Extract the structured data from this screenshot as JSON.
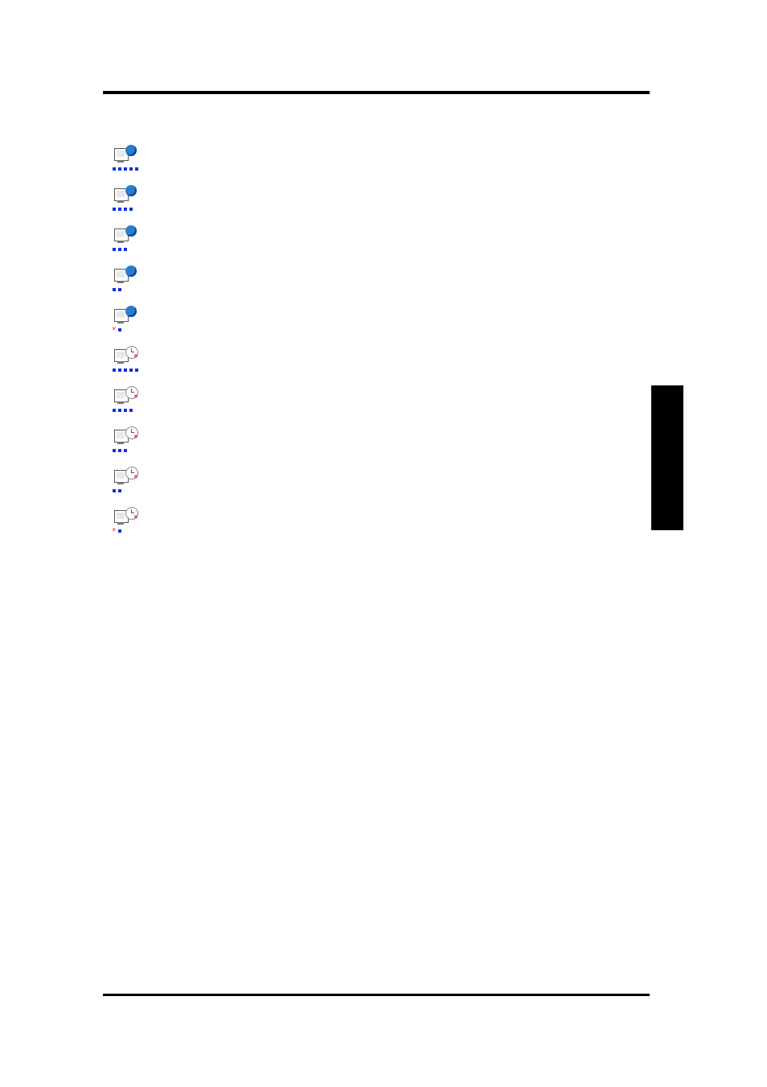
{
  "header": {
    "left": "",
    "right": ""
  },
  "footer": {
    "left": "",
    "right": ""
  },
  "side_tab": "",
  "section_heading": "",
  "icons": [
    {
      "name": "signal-5-globe",
      "badge": "globe",
      "dots": [
        "b",
        "b",
        "b",
        "b",
        "b"
      ],
      "desc": ""
    },
    {
      "name": "signal-4-globe",
      "badge": "globe",
      "dots": [
        "b",
        "b",
        "b",
        "b"
      ],
      "desc": ""
    },
    {
      "name": "signal-3-globe",
      "badge": "globe",
      "dots": [
        "b",
        "b",
        "b"
      ],
      "desc": ""
    },
    {
      "name": "signal-2-globe",
      "badge": "globe",
      "dots": [
        "b",
        "b"
      ],
      "desc": ""
    },
    {
      "name": "signal-1x-globe",
      "badge": "globe",
      "dots": [
        "x",
        "b"
      ],
      "desc": ""
    },
    {
      "name": "signal-5-clock-off",
      "badge": "clock",
      "badge_x": true,
      "dots": [
        "b",
        "b",
        "b",
        "b",
        "b"
      ],
      "desc": ""
    },
    {
      "name": "signal-4-clock-off",
      "badge": "clock",
      "badge_x": true,
      "dots": [
        "b",
        "b",
        "b",
        "b"
      ],
      "desc": ""
    },
    {
      "name": "signal-3-clock-off",
      "badge": "clock",
      "badge_x": true,
      "dots": [
        "b",
        "b",
        "b"
      ],
      "desc": ""
    },
    {
      "name": "signal-2-clock-off",
      "badge": "clock",
      "badge_x": true,
      "dots": [
        "b",
        "b"
      ],
      "desc": ""
    },
    {
      "name": "signal-1x-clock-off",
      "badge": "clock",
      "badge_x": true,
      "dots": [
        "x",
        "b"
      ],
      "desc": ""
    }
  ],
  "paragraphs": []
}
